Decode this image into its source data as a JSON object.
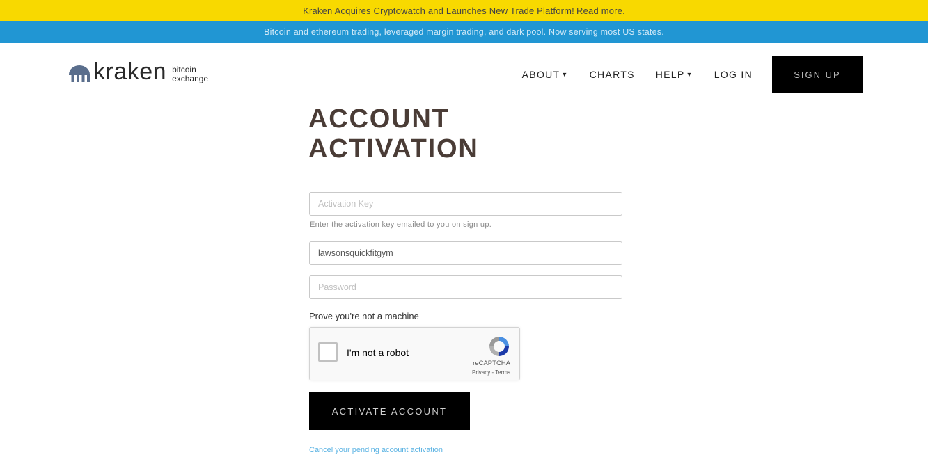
{
  "banner_top": {
    "text": "Kraken Acquires Cryptowatch and Launches New Trade Platform!",
    "link": "Read more."
  },
  "banner_sub": {
    "text": "Bitcoin and ethereum trading, leveraged margin trading, and dark pool. Now serving most US states."
  },
  "header": {
    "logo_word": "kraken",
    "logo_sub_1": "bitcoin",
    "logo_sub_2": "exchange",
    "nav": {
      "about": "ABOUT",
      "charts": "CHARTS",
      "help": "HELP",
      "login": "LOG IN",
      "signup": "SIGN UP"
    }
  },
  "main": {
    "title": "ACCOUNT ACTIVATION",
    "activation_key": {
      "placeholder": "Activation Key",
      "value": ""
    },
    "activation_help": "Enter the activation key emailed to you on sign up.",
    "username": {
      "value": "lawsonsquickfitgym"
    },
    "password": {
      "placeholder": "Password",
      "value": ""
    },
    "captcha_label": "Prove you're not a machine",
    "recaptcha": {
      "label": "I'm not a robot",
      "brand": "reCAPTCHA",
      "privacy": "Privacy",
      "separator": "-",
      "terms": "Terms"
    },
    "activate_button": "ACTIVATE ACCOUNT",
    "cancel_link": "Cancel your pending account activation"
  },
  "colors": {
    "banner_yellow": "#f8d900",
    "banner_blue": "#2196d3",
    "button_black": "#000000",
    "title": "#4a3c36",
    "link": "#5bb3e3",
    "logo_icon": "#5a6e8c"
  }
}
